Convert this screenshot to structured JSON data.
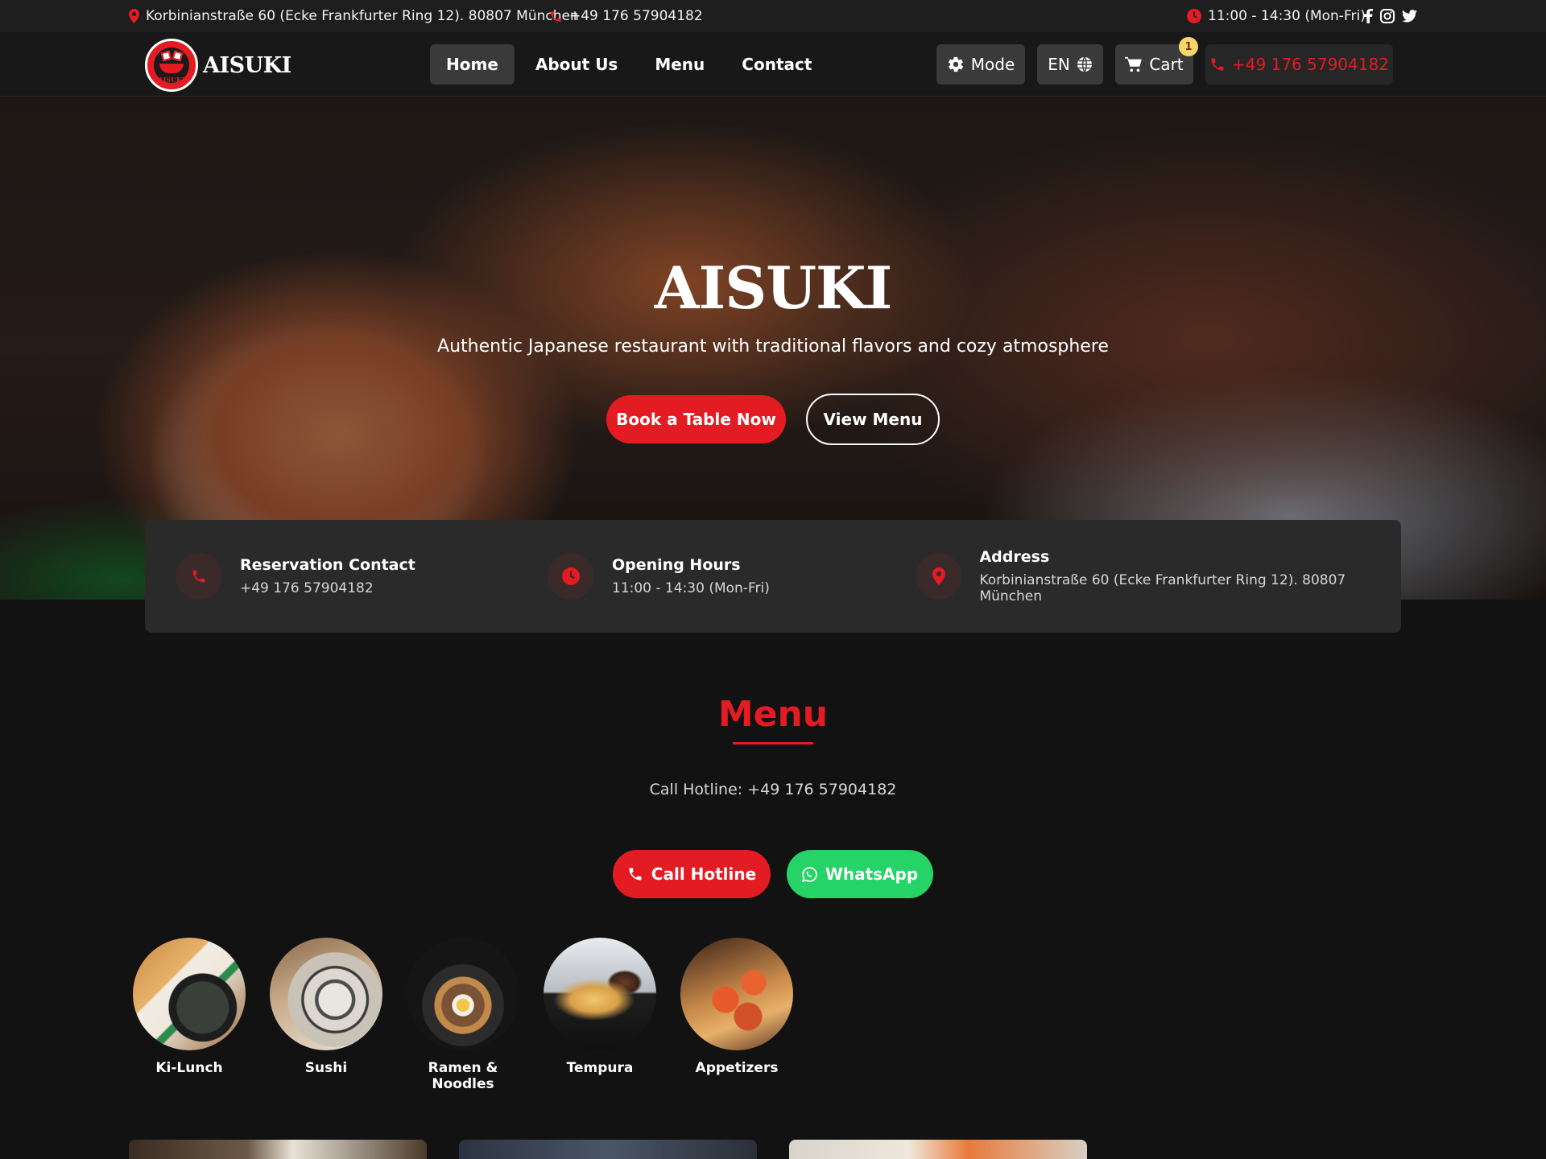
{
  "topbar": {
    "address": "Korbinianstraße 60 (Ecke Frankfurter Ring 12). 80807 München",
    "phone": "+49 176 57904182",
    "hours": "11:00 - 14:30 (Mon-Fri)",
    "social_icons": [
      "facebook-icon",
      "instagram-icon",
      "twitter-icon"
    ]
  },
  "header": {
    "logo_text": "AISUKI",
    "logo_badge_text": "AISUKI",
    "nav": [
      "Home",
      "About Us",
      "Menu",
      "Contact"
    ],
    "active_nav": "Home",
    "mode_label": "Mode",
    "lang_label": "EN",
    "cart_label": "Cart",
    "cart_count": "1",
    "phone_label": "+49 176 57904182"
  },
  "hero": {
    "title": "AISUKI",
    "subtitle": "Authentic Japanese restaurant with traditional flavors and cozy atmosphere",
    "book_button": "Book a Table Now",
    "menu_button": "View Menu"
  },
  "info": [
    {
      "title": "Reservation Contact",
      "value": "+49 176 57904182",
      "icon": "phone-icon"
    },
    {
      "title": "Opening Hours",
      "value": "11:00 - 14:30 (Mon-Fri)",
      "icon": "clock-icon"
    },
    {
      "title": "Address",
      "value": "Korbinianstraße 60 (Ecke Frankfurter Ring 12). 80807 München",
      "icon": "location-pin-icon"
    }
  ],
  "menu": {
    "title": "Menu",
    "hotline_text": "Call Hotline: +49 176 57904182",
    "call_button": "Call Hotline",
    "whatsapp_button": "WhatsApp",
    "categories": [
      "Ki-Lunch",
      "Sushi",
      "Ramen & Noodles",
      "Tempura",
      "Appetizers"
    ]
  },
  "colors": {
    "accent": "#e31b23",
    "whatsapp": "#25d366",
    "background": "#121212",
    "card": "#2a2a2a"
  }
}
